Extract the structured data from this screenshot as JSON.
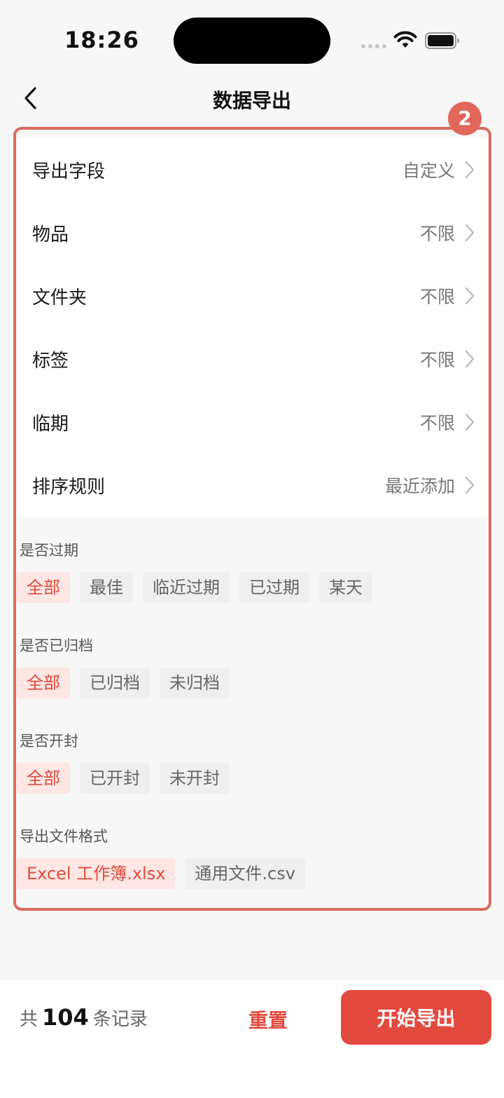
{
  "status_bar": {
    "time": "18:26"
  },
  "nav": {
    "title": "数据导出"
  },
  "annotation": {
    "badge": "2"
  },
  "rows": [
    {
      "label": "导出字段",
      "value": "自定义"
    },
    {
      "label": "物品",
      "value": "不限"
    },
    {
      "label": "文件夹",
      "value": "不限"
    },
    {
      "label": "标签",
      "value": "不限"
    },
    {
      "label": "临期",
      "value": "不限"
    },
    {
      "label": "排序规则",
      "value": "最近添加"
    }
  ],
  "filters": {
    "expired": {
      "title": "是否过期",
      "options": [
        "全部",
        "最佳",
        "临近过期",
        "已过期",
        "某天"
      ],
      "selected": "全部"
    },
    "archived": {
      "title": "是否已归档",
      "options": [
        "全部",
        "已归档",
        "未归档"
      ],
      "selected": "全部"
    },
    "opened": {
      "title": "是否开封",
      "options": [
        "全部",
        "已开封",
        "未开封"
      ],
      "selected": "全部"
    },
    "format": {
      "title": "导出文件格式",
      "options": [
        "Excel 工作簿.xlsx",
        "通用文件.csv"
      ],
      "selected": "Excel 工作簿.xlsx"
    }
  },
  "bottom": {
    "count_prefix": "共",
    "count": "104",
    "count_suffix": "条记录",
    "reset_label": "重置",
    "start_label": "开始导出"
  },
  "colors": {
    "accent": "#e34a3f",
    "highlight_frame": "#d86b5e",
    "chip_active_bg": "#fde6e3"
  }
}
